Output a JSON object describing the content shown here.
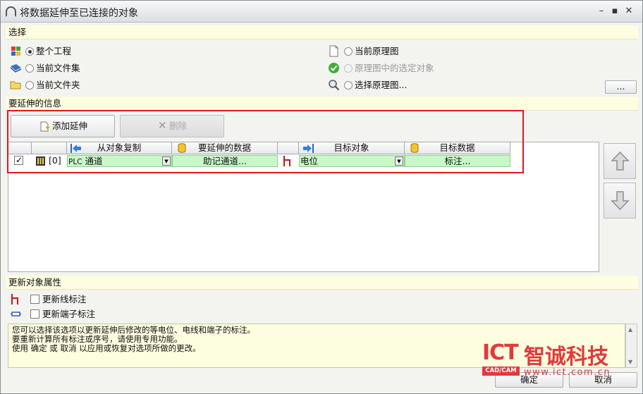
{
  "window": {
    "title": "将数据延伸至已连接的对象",
    "minimize": "–",
    "maximize": "▪",
    "close": "✕"
  },
  "selection": {
    "header": "选择",
    "left_options": [
      {
        "label": "整个工程",
        "checked": true,
        "icon": "project-icon"
      },
      {
        "label": "当前文件集",
        "checked": false,
        "icon": "fileset-icon"
      },
      {
        "label": "当前文件夹",
        "checked": false,
        "icon": "folder-icon"
      }
    ],
    "right_options": [
      {
        "label": "当前原理图",
        "checked": true,
        "disabled": false,
        "icon": "document-icon"
      },
      {
        "label": "原理图中的选定对象",
        "checked": false,
        "disabled": true,
        "icon": "green-check-icon"
      },
      {
        "label": "选择原理图...",
        "checked": false,
        "disabled": false,
        "icon": "magnifier-icon"
      }
    ],
    "browse_button": "..."
  },
  "extend_info": {
    "header": "要延伸的信息",
    "add_button": "添加延伸",
    "delete_button": "删除",
    "columns": [
      "从对象复制",
      "要延伸的数据",
      "目标对象",
      "目标数据"
    ],
    "rows": [
      {
        "checked": true,
        "index": "[0]",
        "source_prefix": "PLC",
        "source_object": "通道",
        "source_data": "助记通道...",
        "target_object": "电位",
        "target_data": "标注..."
      }
    ],
    "up_arrow": "⇧",
    "down_arrow": "⇩"
  },
  "update": {
    "header": "更新对象属性",
    "options": [
      {
        "label": "更新线标注",
        "checked": false
      },
      {
        "label": "更新端子标注",
        "checked": false
      }
    ]
  },
  "description": [
    "您可以选择该选项以更新延伸后修改的等电位、电线和端子的标注。",
    "要重新计算所有标注或序号，请使用专用功能。",
    "使用 确定 或 取消 以应用或恢复对选项所做的更改。"
  ],
  "footer": {
    "ok": "确定",
    "cancel": "取消"
  },
  "watermark": {
    "logo": "ICT",
    "name": "智诚科技",
    "sub": "CAD/CAM",
    "url": "www.ict.com.cn"
  },
  "colors": {
    "section_bar": "#fdfde0",
    "highlight_red": "#e01820",
    "cell_green": "#c8f7c8",
    "watermark_red": "#e23a3a"
  }
}
